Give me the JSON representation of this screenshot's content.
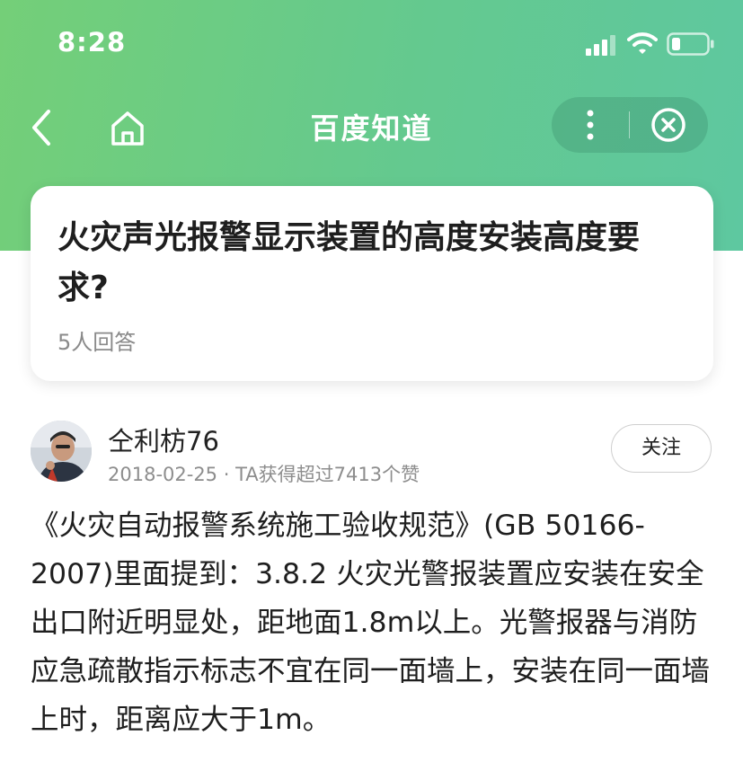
{
  "status_bar": {
    "time": "8:28"
  },
  "nav": {
    "title": "百度知道"
  },
  "question": {
    "title": "火灾声光报警显示装置的高度安装高度要求?",
    "answer_count": "5人回答"
  },
  "answer": {
    "author_name": "仝利枋76",
    "meta": "2018-02-25 · TA获得超过7413个赞",
    "follow_label": "关注",
    "content": "《火灾自动报警系统施工验收规范》(GB 50166-2007)里面提到：3.8.2 火灾光警报装置应安装在安全出口附近明显处，距地面1.8m以上。光警报器与消防应急疏散指示标志不宜在同一面墙上，安装在同一面墙上时，距离应大于1m。"
  },
  "colors": {
    "header_gradient_start": "#74cf78",
    "header_gradient_end": "#5ec8a0",
    "card_background": "#ffffff",
    "secondary_text": "#8a8a8a"
  },
  "icons": [
    "signal-icon",
    "wifi-icon",
    "battery-icon",
    "back-arrow-icon",
    "home-icon",
    "more-dots-icon",
    "close-circle-icon"
  ]
}
